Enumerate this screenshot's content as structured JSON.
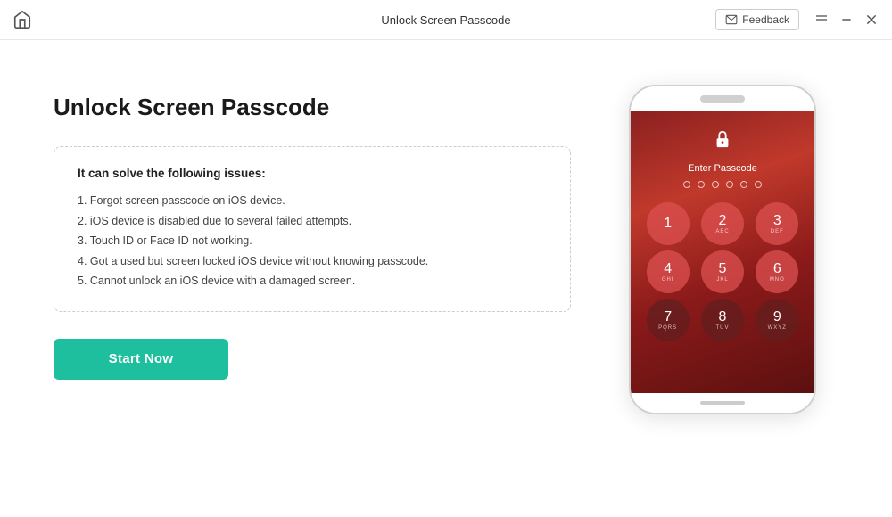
{
  "titlebar": {
    "title": "Unlock Screen Passcode",
    "feedback_label": "Feedback",
    "home_icon": "⌂"
  },
  "main": {
    "page_title": "Unlock Screen Passcode",
    "issues_box": {
      "title": "It can solve the following issues:",
      "items": [
        "1. Forgot screen passcode on iOS device.",
        "2. iOS device is disabled due to several failed attempts.",
        "3. Touch ID or Face ID not working.",
        "4. Got a used but screen locked iOS device without knowing passcode.",
        "5. Cannot unlock an iOS device with a damaged screen."
      ]
    },
    "start_button": "Start Now"
  },
  "phone": {
    "enter_passcode": "Enter Passcode",
    "numpad": [
      {
        "main": "1",
        "sub": ""
      },
      {
        "main": "2",
        "sub": "ABC"
      },
      {
        "main": "3",
        "sub": "DEF"
      },
      {
        "main": "4",
        "sub": "GHI"
      },
      {
        "main": "5",
        "sub": "JKL"
      },
      {
        "main": "6",
        "sub": "MNO"
      },
      {
        "main": "7",
        "sub": "PQRS"
      },
      {
        "main": "8",
        "sub": "TUV"
      },
      {
        "main": "9",
        "sub": "WXYZ"
      }
    ]
  },
  "colors": {
    "start_btn": "#1dbf9e",
    "title_color": "#1a1a1a"
  }
}
